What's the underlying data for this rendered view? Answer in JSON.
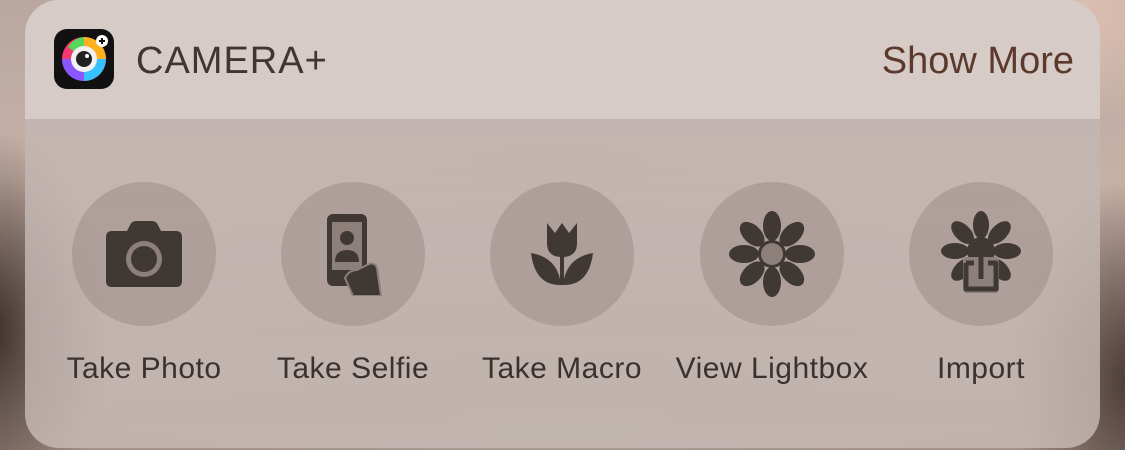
{
  "widget": {
    "app_name": "CAMERA+",
    "show_more_label": "Show More",
    "app_icon": "camera-plus-app-icon"
  },
  "actions": [
    {
      "label": "Take Photo",
      "icon": "camera-icon"
    },
    {
      "label": "Take Selfie",
      "icon": "selfie-icon"
    },
    {
      "label": "Take Macro",
      "icon": "tulip-macro-icon"
    },
    {
      "label": "View Lightbox",
      "icon": "flower-lightbox-icon"
    },
    {
      "label": "Import",
      "icon": "flower-import-icon"
    }
  ],
  "colors": {
    "icon_fill": "#3f3835",
    "show_more": "#5b3a2c",
    "text": "#3a322f"
  }
}
